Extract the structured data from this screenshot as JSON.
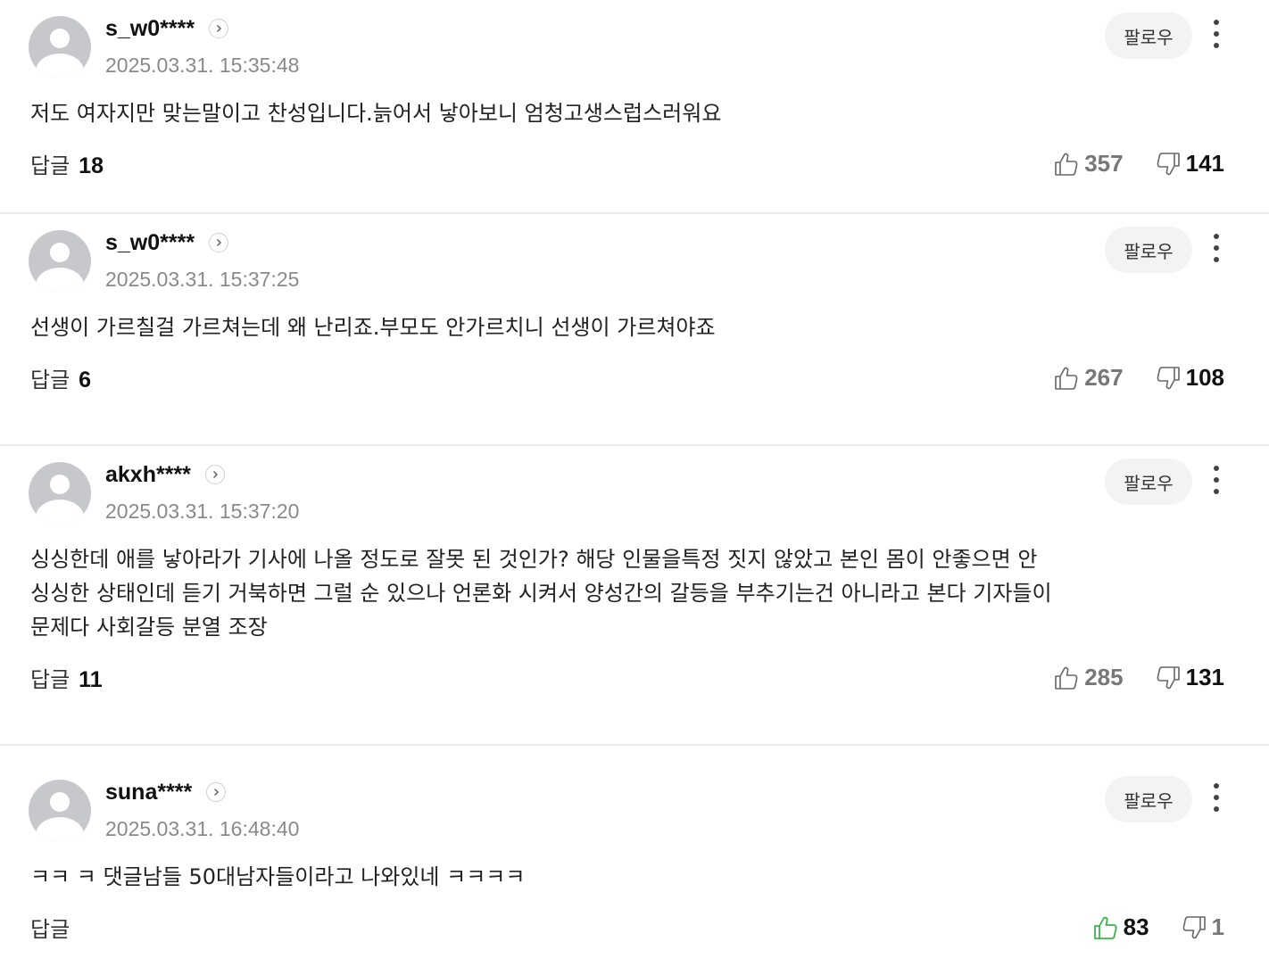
{
  "comments": [
    {
      "nickname": "s_w0****",
      "date": "2025.03.31. 15:35:48",
      "follow_label": "팔로우",
      "text_lines": [
        "저도 여자지만 맞는말이고 찬성입니다.늙어서 낳아보니 엄청고생스럽스러워요"
      ],
      "reply_label": "답글",
      "reply_count": "18",
      "likes": "357",
      "dislikes": "141",
      "like_active": false
    },
    {
      "nickname": "s_w0****",
      "date": "2025.03.31. 15:37:25",
      "follow_label": "팔로우",
      "text_lines": [
        "선생이 가르칠걸 가르쳐는데 왜 난리죠.부모도 안가르치니 선생이 가르쳐야죠"
      ],
      "reply_label": "답글",
      "reply_count": "6",
      "likes": "267",
      "dislikes": "108",
      "like_active": false
    },
    {
      "nickname": "akxh****",
      "date": "2025.03.31. 15:37:20",
      "follow_label": "팔로우",
      "text_lines": [
        "싱싱한데 애를 낳아라가 기사에 나올 정도로 잘못 된 것인가? 해당 인물을특정 짓지 않았고 본인 몸이 안좋으면 안",
        "싱싱한 상태인데 듣기 거북하면 그럴 순 있으나 언론화 시켜서 양성간의 갈등을 부추기는건 아니라고 본다 기자들이",
        "문제다 사회갈등 분열 조장"
      ],
      "reply_label": "답글",
      "reply_count": "11",
      "likes": "285",
      "dislikes": "131",
      "like_active": false
    },
    {
      "nickname": "suna****",
      "date": "2025.03.31. 16:48:40",
      "follow_label": "팔로우",
      "text_lines": [
        "ㅋㅋ ㅋ 댓글남들 50대남자들이라고 나와있네 ㅋㅋㅋㅋ"
      ],
      "reply_label": "답글",
      "reply_count": "",
      "likes": "83",
      "dislikes": "1",
      "like_active": true
    }
  ],
  "colors": {
    "like_active": "#3cb44b",
    "icon_gray": "#666666",
    "follow_bg": "#f3f3f3",
    "divider": "#ebebeb"
  },
  "icons": {
    "like": "thumbs-up-icon",
    "dislike": "thumbs-down-icon",
    "more": "more-vertical-icon",
    "profile_go": "chevron-right-icon",
    "avatar": "default-avatar-icon"
  }
}
